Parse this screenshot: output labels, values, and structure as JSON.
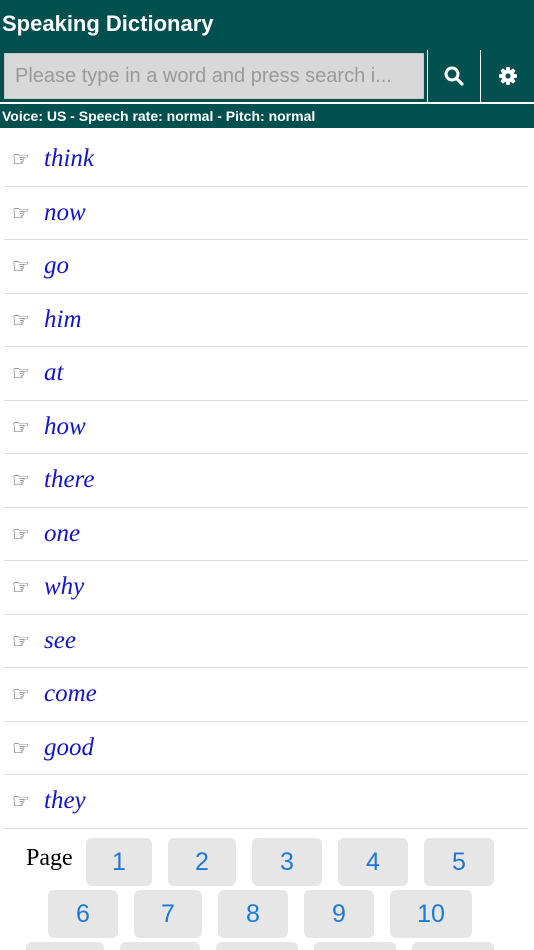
{
  "header": {
    "title": "Speaking Dictionary",
    "search_placeholder": "Please type in a word and press search i...",
    "search_icon": "search-icon",
    "settings_icon": "gear-icon",
    "voice_line": "Voice: US - Speech rate: normal - Pitch: normal",
    "background_color": "#005050"
  },
  "words": [
    {
      "icon": "pointing-hand-icon",
      "label": "think"
    },
    {
      "icon": "pointing-hand-icon",
      "label": "now"
    },
    {
      "icon": "pointing-hand-icon",
      "label": "go"
    },
    {
      "icon": "pointing-hand-icon",
      "label": "him"
    },
    {
      "icon": "pointing-hand-icon",
      "label": "at"
    },
    {
      "icon": "pointing-hand-icon",
      "label": "how"
    },
    {
      "icon": "pointing-hand-icon",
      "label": "there"
    },
    {
      "icon": "pointing-hand-icon",
      "label": "one"
    },
    {
      "icon": "pointing-hand-icon",
      "label": "why"
    },
    {
      "icon": "pointing-hand-icon",
      "label": "see"
    },
    {
      "icon": "pointing-hand-icon",
      "label": "come"
    },
    {
      "icon": "pointing-hand-icon",
      "label": "good"
    },
    {
      "icon": "pointing-hand-icon",
      "label": "they"
    }
  ],
  "word_color": "#1414c8",
  "pagination": {
    "label": "Page",
    "pages": [
      "1",
      "2",
      "3",
      "4",
      "5",
      "6",
      "7",
      "8",
      "9",
      "10"
    ],
    "button_text_color": "#1a7ad8"
  }
}
